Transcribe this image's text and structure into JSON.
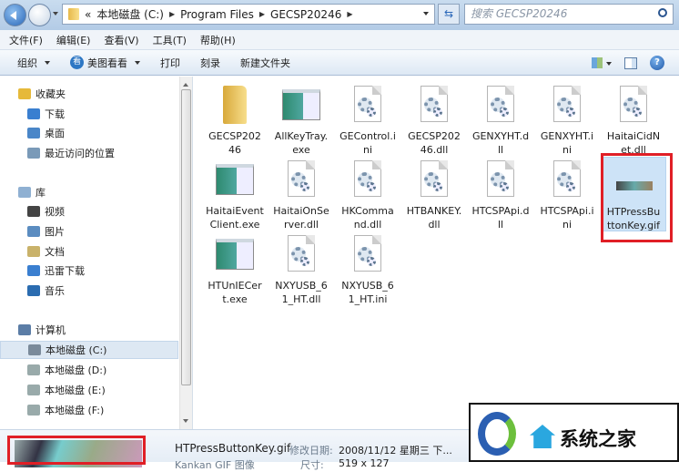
{
  "address": {
    "crumbs": [
      "«",
      "本地磁盘 (C:)",
      "Program Files",
      "GECSP20246"
    ],
    "search_placeholder": "搜索 GECSP20246"
  },
  "menu": [
    "文件(F)",
    "编辑(E)",
    "查看(V)",
    "工具(T)",
    "帮助(H)"
  ],
  "toolbar": {
    "organize": "组织",
    "meitu": "美图看看",
    "print": "打印",
    "burn": "刻录",
    "new_folder": "新建文件夹"
  },
  "sidebar": [
    {
      "label": "收藏夹",
      "icon": "star-icon",
      "color": "#e6b93a",
      "group": true
    },
    {
      "label": "下载",
      "icon": "download-folder-icon",
      "color": "#3a7fd0"
    },
    {
      "label": "桌面",
      "icon": "desktop-icon",
      "color": "#4a86c8"
    },
    {
      "label": "最近访问的位置",
      "icon": "recent-places-icon",
      "color": "#7a9ab8"
    },
    {
      "label": "库",
      "icon": "library-icon",
      "color": "#8fb0d2",
      "group": true
    },
    {
      "label": "视频",
      "icon": "video-icon",
      "color": "#444"
    },
    {
      "label": "图片",
      "icon": "pictures-icon",
      "color": "#5b8cc0"
    },
    {
      "label": "文档",
      "icon": "documents-icon",
      "color": "#c9b26a"
    },
    {
      "label": "迅雷下载",
      "icon": "thunder-download-icon",
      "color": "#3a7fd0"
    },
    {
      "label": "音乐",
      "icon": "music-icon",
      "color": "#2b6cb0"
    },
    {
      "label": "计算机",
      "icon": "computer-icon",
      "color": "#5b7da6",
      "group": true
    },
    {
      "label": "本地磁盘 (C:)",
      "icon": "drive-c-icon",
      "color": "#7a8a9a",
      "selected": true
    },
    {
      "label": "本地磁盘 (D:)",
      "icon": "drive-icon",
      "color": "#9aa"
    },
    {
      "label": "本地磁盘 (E:)",
      "icon": "drive-icon",
      "color": "#9aa"
    },
    {
      "label": "本地磁盘 (F:)",
      "icon": "drive-icon",
      "color": "#9aa"
    }
  ],
  "files": [
    {
      "name": "GECSP20246",
      "type": "folder"
    },
    {
      "name": "AllKeyTray.exe",
      "type": "exe"
    },
    {
      "name": "GEControl.ini",
      "type": "ini"
    },
    {
      "name": "GECSP20246.dll",
      "type": "dll"
    },
    {
      "name": "GENXYHT.dll",
      "type": "dll"
    },
    {
      "name": "GENXYHT.ini",
      "type": "ini"
    },
    {
      "name": "HaitaiCidNet.dll",
      "type": "dll"
    },
    {
      "name": "HaitaiEventClient.exe",
      "type": "exe"
    },
    {
      "name": "HaitaiOnServer.dll",
      "type": "dll"
    },
    {
      "name": "HKCommand.dll",
      "type": "dll"
    },
    {
      "name": "HTBANKEY.dll",
      "type": "dll"
    },
    {
      "name": "HTCSPApi.dll",
      "type": "dll"
    },
    {
      "name": "HTCSPApi.ini",
      "type": "ini"
    },
    {
      "name": "HTPressButtonKey.gif",
      "type": "gif",
      "selected": true
    },
    {
      "name": "HTUnIECert.exe",
      "type": "exe"
    },
    {
      "name": "NXYUSB_61_HT.dll",
      "type": "dll"
    },
    {
      "name": "NXYUSB_61_HT.ini",
      "type": "ini"
    }
  ],
  "details": {
    "filename": "HTPressButtonKey.gif",
    "modified_label": "修改日期:",
    "modified_value": "2008/11/12 星期三 下...",
    "type": "Kankan GIF 图像",
    "size_label": "尺寸:",
    "size_value": "519 x 127"
  },
  "watermark": {
    "text": "系统之家"
  },
  "colors": {
    "highlight": "#e01f26",
    "selection": "#cde3f7"
  }
}
